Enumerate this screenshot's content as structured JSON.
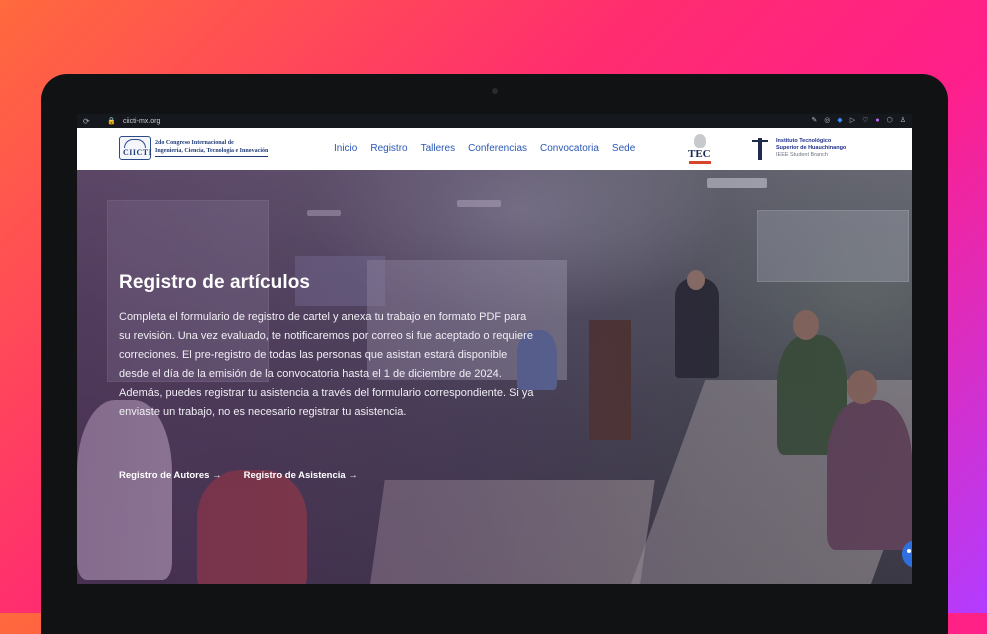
{
  "browser": {
    "url": "ciicti-mx.org",
    "icons": [
      "reload-icon",
      "lock-icon",
      "edit-icon",
      "camera-icon",
      "shield-icon",
      "play-icon",
      "heart-icon",
      "extension-icon",
      "cube-icon",
      "profile-icon"
    ]
  },
  "site": {
    "brand_logo": "CIICTI",
    "brand_line1": "2do Congreso Internacional de",
    "brand_line2": "Ingeniería, Ciencia, Tecnología e Innovación",
    "nav": [
      "Inicio",
      "Registro",
      "Talleres",
      "Conferencias",
      "Convocatoria",
      "Sede"
    ],
    "tec_logo": "TEC",
    "ith_line1": "Instituto Tecnológico",
    "ith_line2": "Superior de Huauchinango",
    "ith_line3": "IEEE Student Branch"
  },
  "hero": {
    "title": "Registro de artículos",
    "body": "Completa el formulario de registro de cartel y anexa tu trabajo en formato PDF para su revisión. Una vez evaluado, te notificaremos por correo si fue aceptado o requiere correciones. El pre-registro de todas las personas que asistan estará disponible desde el día de la emisión de la convocatoria hasta el 1 de diciembre de 2024. Además, puedes registrar tu asistencia a través del formulario correspondiente. Si ya enviaste un trabajo, no es necesario registrar tu asistencia.",
    "link_authors": "Registro de Autores →",
    "link_attendance": "Registro de Asistencia →"
  },
  "colors": {
    "nav_link": "#2a58b5",
    "background_gradient_start": "#ff6a3d",
    "background_gradient_end": "#b23cff"
  }
}
